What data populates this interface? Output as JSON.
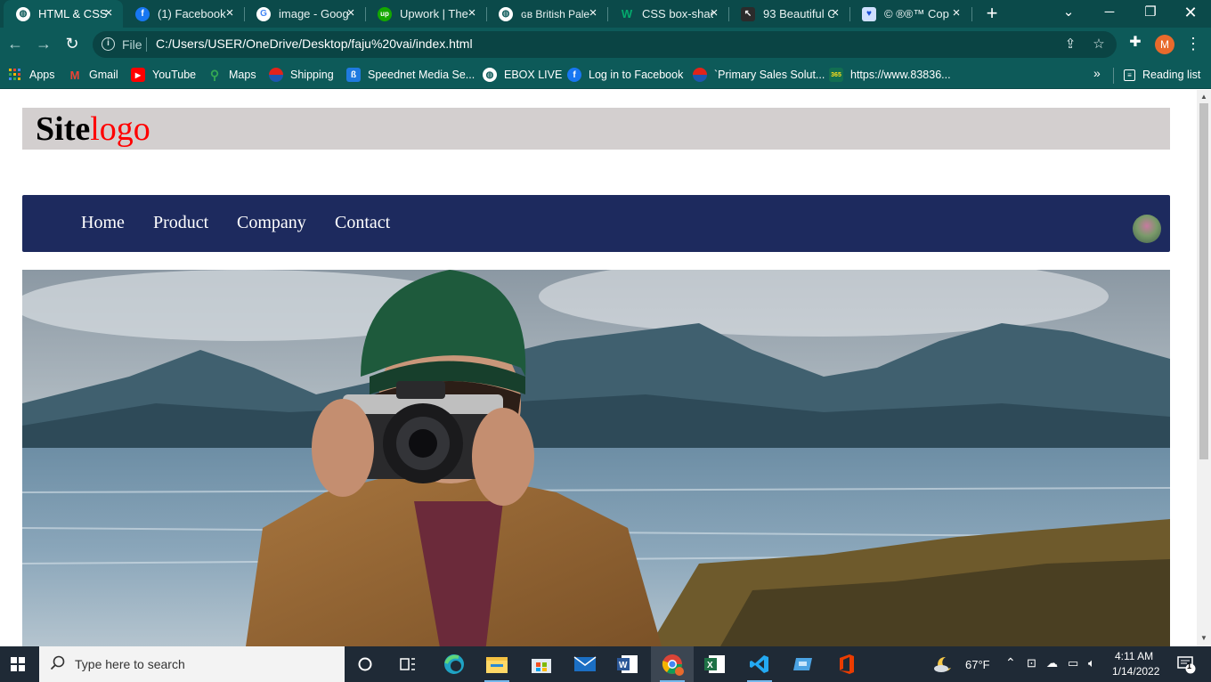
{
  "browser": {
    "tabs": [
      {
        "title": "HTML & CSS",
        "icon": "globe-icon",
        "active": true
      },
      {
        "title": "(1) Facebook",
        "icon": "facebook-icon"
      },
      {
        "title": "image - Goog",
        "icon": "google-icon"
      },
      {
        "title": "Upwork | The",
        "icon": "upwork-icon"
      },
      {
        "title": "ɢʙ British Pale",
        "icon": "globe-icon"
      },
      {
        "title": "CSS box-shad",
        "icon": "w3-icon"
      },
      {
        "title": "93 Beautiful C",
        "icon": "cursor-icon"
      },
      {
        "title": "© ®®™ Cop",
        "icon": "heart-icon"
      }
    ],
    "address": {
      "scheme": "File",
      "url": "C:/Users/USER/OneDrive/Desktop/faju%20vai/index.html"
    },
    "profile_initial": "M",
    "bookmarks": [
      {
        "label": "Apps",
        "icon": "apps-grid-icon"
      },
      {
        "label": "Gmail",
        "icon": "gmail-icon"
      },
      {
        "label": "YouTube",
        "icon": "youtube-icon"
      },
      {
        "label": "Maps",
        "icon": "maps-icon"
      },
      {
        "label": "Shipping",
        "icon": "pepsi-icon"
      },
      {
        "label": "Speednet Media Se...",
        "icon": "speednet-icon"
      },
      {
        "label": "EBOX LIVE",
        "icon": "globe-icon"
      },
      {
        "label": "Log in to Facebook",
        "icon": "facebook-icon"
      },
      {
        "label": "`Primary Sales Solut...",
        "icon": "pepsi-icon"
      },
      {
        "label": "https://www.83836...",
        "icon": "bet365-icon"
      }
    ],
    "bookmarks_more": "»",
    "reading_list": "Reading list"
  },
  "page": {
    "logo_part_a": "Site",
    "logo_part_b": "logo",
    "nav": [
      "Home",
      "Product",
      "Company",
      "Contact"
    ],
    "hero_alt": "photographer"
  },
  "taskbar": {
    "search_placeholder": "Type here to search",
    "weather": "67°F",
    "time": "4:11 AM",
    "date": "1/14/2022",
    "notification_count": "1"
  },
  "colors": {
    "chrome_frame": "#0b4a4a",
    "chrome_toolbar": "#0d5a59",
    "site_header_bg": "#d3cfcf",
    "site_nav_bg": "#1d2a5e",
    "logo_accent": "#ff0000"
  }
}
